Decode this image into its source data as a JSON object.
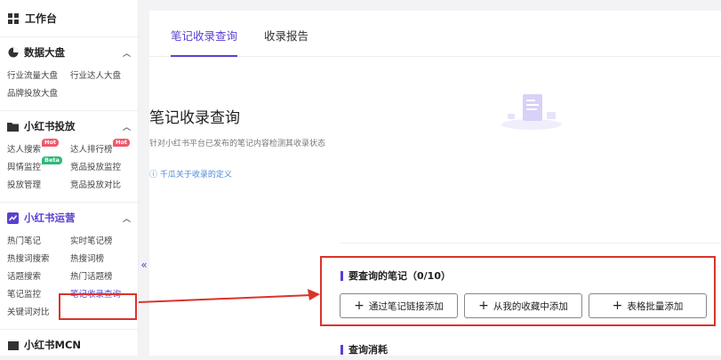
{
  "sidebar": {
    "workbench": "工作台",
    "sections": [
      {
        "title": "数据大盘",
        "items": [
          "行业流量大盘",
          "行业达人大盘",
          "品牌投放大盘"
        ]
      },
      {
        "title": "小红书投放",
        "items": [
          "达人搜索",
          "达人排行榜",
          "舆情监控",
          "竞品投放监控",
          "投放管理",
          "竞品投放对比"
        ],
        "badges": {
          "hot": "Hot",
          "beta": "Beta"
        }
      },
      {
        "title": "小红书运营",
        "items": [
          "热门笔记",
          "实时笔记榜",
          "热搜词搜索",
          "热搜词榜",
          "话题搜索",
          "热门话题榜",
          "笔记监控",
          "笔记收录查询",
          "关键词对比"
        ]
      },
      {
        "title": "小红书MCN"
      }
    ],
    "collapse": "«"
  },
  "main": {
    "tabs": [
      "笔记收录查询",
      "收录报告"
    ],
    "hero_title": "笔记收录查询",
    "hero_desc": "针对小红书平台已发布的笔记内容检测其收录状态",
    "hero_link": "千瓜关于收录的定义",
    "query_title": "要查询的笔记（0/10）",
    "buttons": [
      "通过笔记链接添加",
      "从我的收藏中添加",
      "表格批量添加"
    ],
    "consume_title": "查询消耗"
  },
  "colors": {
    "accent": "#5b3fd1",
    "highlight": "#d9342b",
    "hot": "#f0586a",
    "beta": "#2db87a",
    "link": "#4b8ad6"
  }
}
